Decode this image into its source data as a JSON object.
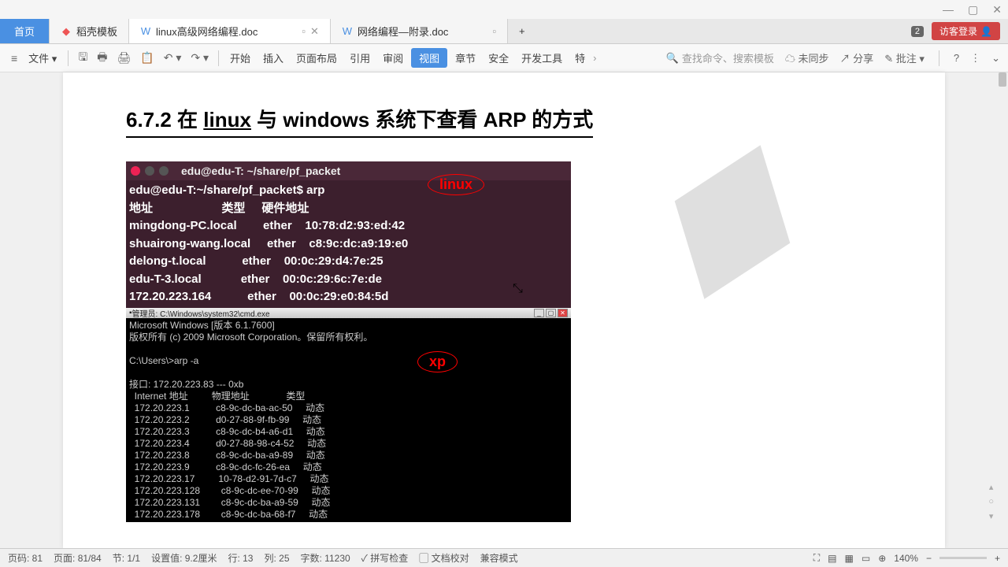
{
  "titlebar": {
    "min": "—",
    "max": "▢",
    "close": "✕"
  },
  "tabs": {
    "home": "首页",
    "t1": "稻壳模板",
    "t2": "linux高级网络编程.doc",
    "t3": "网络编程—附录.doc",
    "badge": "2",
    "login": "访客登录"
  },
  "toolbar": {
    "file": "文件",
    "menus": [
      "开始",
      "插入",
      "页面布局",
      "引用",
      "审阅",
      "视图",
      "章节",
      "安全",
      "开发工具",
      "特"
    ],
    "active_index": 5,
    "search": "查找命令、搜索模板",
    "sync": "未同步",
    "share": "分享",
    "annotate": "批注"
  },
  "document": {
    "heading_num": "6.7.2 在 ",
    "heading_u1": "linux",
    "heading_mid": " 与 windows  系统下查看 ",
    "heading_b": "ARP",
    "heading_end": " 的方式",
    "linux_label": "linux",
    "linux_title": "edu@edu-T: ~/share/pf_packet",
    "linux_lines": [
      "edu@edu-T:~/share/pf_packet$ arp",
      "地址                     类型     硬件地址",
      "mingdong-PC.local        ether    10:78:d2:93:ed:42",
      "shuairong-wang.local     ether    c8:9c:dc:a9:19:e0",
      "delong-t.local           ether    00:0c:29:d4:7e:25",
      "edu-T-3.local            ether    00:0c:29:6c:7e:de",
      "172.20.223.164           ether    00:0c:29:e0:84:5d"
    ],
    "xp_label": "xp",
    "xp_title": "管理员: C:\\Windows\\system32\\cmd.exe",
    "xp_lines": [
      "Microsoft Windows [版本 6.1.7600]",
      "版权所有 (c) 2009 Microsoft Corporation。保留所有权利。",
      "",
      "C:\\Users\\>arp -a",
      "",
      "接口: 172.20.223.83 --- 0xb",
      "  Internet 地址         物理地址              类型",
      "  172.20.223.1          c8-9c-dc-ba-ac-50     动态",
      "  172.20.223.2          d0-27-88-9f-fb-99     动态",
      "  172.20.223.3          c8-9c-dc-b4-a6-d1     动态",
      "  172.20.223.4          d0-27-88-98-c4-52     动态",
      "  172.20.223.8          c8-9c-dc-ba-a9-89     动态",
      "  172.20.223.9          c8-9c-dc-fc-26-ea     动态",
      "  172.20.223.17         10-78-d2-91-7d-c7     动态",
      "  172.20.223.128        c8-9c-dc-ee-70-99     动态",
      "  172.20.223.131        c8-9c-dc-ba-a9-59     动态",
      "  172.20.223.178        c8-9c-dc-ba-68-f7     动态"
    ]
  },
  "status": {
    "page_code": "页码: 81",
    "page": "页面: 81/84",
    "section": "节: 1/1",
    "pos": "设置值: 9.2厘米",
    "row": "行: 13",
    "col": "列: 25",
    "words": "字数: 11230",
    "spell": "拼写检查",
    "proof": "文档校对",
    "compat": "兼容模式",
    "zoom": "140%"
  },
  "chart_data": {
    "type": "table",
    "title": "ARP cache entries (linux & windows)",
    "linux_arp": [
      {
        "address": "mingdong-PC.local",
        "type": "ether",
        "hwaddr": "10:78:d2:93:ed:42"
      },
      {
        "address": "shuairong-wang.local",
        "type": "ether",
        "hwaddr": "c8:9c:dc:a9:19:e0"
      },
      {
        "address": "delong-t.local",
        "type": "ether",
        "hwaddr": "00:0c:29:d4:7e:25"
      },
      {
        "address": "edu-T-3.local",
        "type": "ether",
        "hwaddr": "00:0c:29:6c:7e:de"
      },
      {
        "address": "172.20.223.164",
        "type": "ether",
        "hwaddr": "00:0c:29:e0:84:5d"
      }
    ],
    "windows_interface": "172.20.223.83 --- 0xb",
    "windows_arp": [
      {
        "address": "172.20.223.1",
        "hwaddr": "c8-9c-dc-ba-ac-50",
        "type": "动态"
      },
      {
        "address": "172.20.223.2",
        "hwaddr": "d0-27-88-9f-fb-99",
        "type": "动态"
      },
      {
        "address": "172.20.223.3",
        "hwaddr": "c8-9c-dc-b4-a6-d1",
        "type": "动态"
      },
      {
        "address": "172.20.223.4",
        "hwaddr": "d0-27-88-98-c4-52",
        "type": "动态"
      },
      {
        "address": "172.20.223.8",
        "hwaddr": "c8-9c-dc-ba-a9-89",
        "type": "动态"
      },
      {
        "address": "172.20.223.9",
        "hwaddr": "c8-9c-dc-fc-26-ea",
        "type": "动态"
      },
      {
        "address": "172.20.223.17",
        "hwaddr": "10-78-d2-91-7d-c7",
        "type": "动态"
      },
      {
        "address": "172.20.223.128",
        "hwaddr": "c8-9c-dc-ee-70-99",
        "type": "动态"
      },
      {
        "address": "172.20.223.131",
        "hwaddr": "c8-9c-dc-ba-a9-59",
        "type": "动态"
      },
      {
        "address": "172.20.223.178",
        "hwaddr": "c8-9c-dc-ba-68-f7",
        "type": "动态"
      }
    ]
  }
}
